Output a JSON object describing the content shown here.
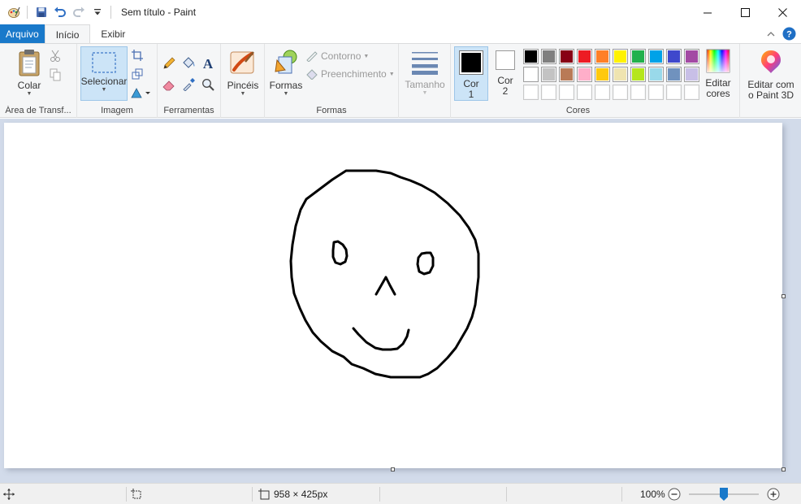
{
  "window": {
    "title": "Sem título - Paint"
  },
  "tabs": {
    "file": "Arquivo",
    "home": "Início",
    "view": "Exibir"
  },
  "ribbon": {
    "clipboard": {
      "paste": "Colar",
      "label": "Área de Transf..."
    },
    "image": {
      "select": "Selecionar",
      "label": "Imagem"
    },
    "tools": {
      "label": "Ferramentas"
    },
    "brushes": {
      "label": "Pincéis"
    },
    "shapes": {
      "shapes": "Formas",
      "outline": "Contorno",
      "fill": "Preenchimento",
      "label": "Formas"
    },
    "size": {
      "label": "Tamanho"
    },
    "colors": {
      "color1_line1": "Cor",
      "color1_line2": "1",
      "color2_line1": "Cor",
      "color2_line2": "2",
      "edit_line1": "Editar",
      "edit_line2": "cores",
      "label": "Cores",
      "color1_value": "#000000",
      "color2_value": "#ffffff",
      "palette_row1": [
        "#000000",
        "#7f7f7f",
        "#880015",
        "#ed1c24",
        "#ff7f27",
        "#fff200",
        "#22b14c",
        "#00a2e8",
        "#3f48cc",
        "#a349a4"
      ],
      "palette_row2": [
        "#ffffff",
        "#c3c3c3",
        "#b97a57",
        "#ffaec9",
        "#ffc90e",
        "#efe4b0",
        "#b5e61d",
        "#99d9ea",
        "#7092be",
        "#c8bfe7"
      ],
      "palette_row3": [
        "#ffffff",
        "#ffffff",
        "#ffffff",
        "#ffffff",
        "#ffffff",
        "#ffffff",
        "#ffffff",
        "#ffffff",
        "#ffffff",
        "#ffffff"
      ]
    },
    "paint3d": {
      "line1": "Editar com",
      "line2": "o Paint 3D"
    }
  },
  "status": {
    "canvas_size": "958 × 425px",
    "zoom": "100%"
  },
  "colors": {
    "accent": "#1979ca",
    "workspace": "#d2dbea",
    "selected": "#cce4f7"
  }
}
